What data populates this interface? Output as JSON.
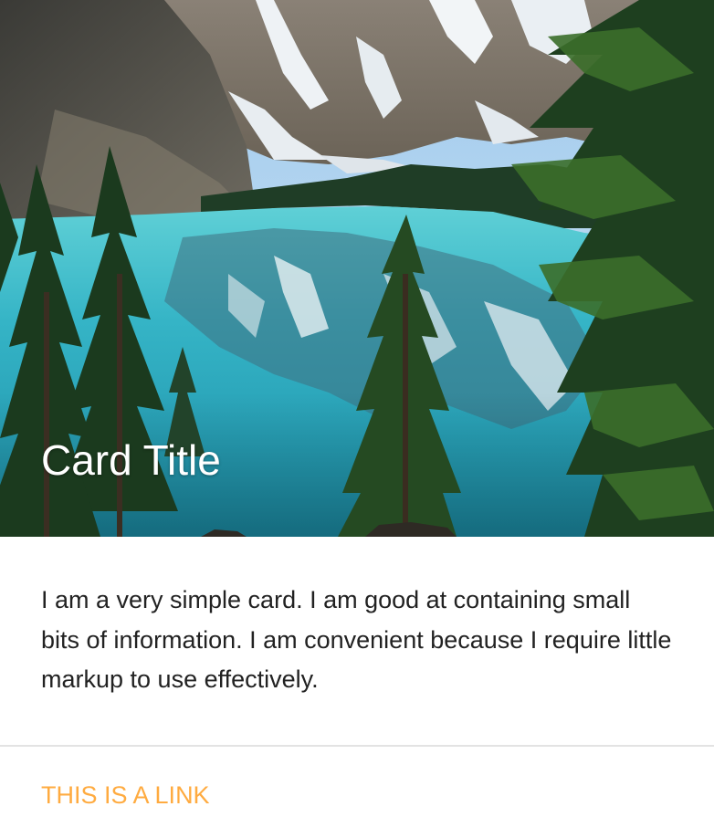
{
  "card": {
    "image": {
      "alt_subject": "mountain-lake-photo"
    },
    "title": "Card Title",
    "content": "I am a very simple card. I am good at containing small bits of information. I am convenient because I require little markup to use effectively.",
    "action": {
      "link_label": "THIS IS A LINK"
    }
  },
  "colors": {
    "title": "#ffffff",
    "text": "#222222",
    "link": "#ffab40",
    "divider": "#e3e3e3",
    "background": "#ffffff"
  }
}
